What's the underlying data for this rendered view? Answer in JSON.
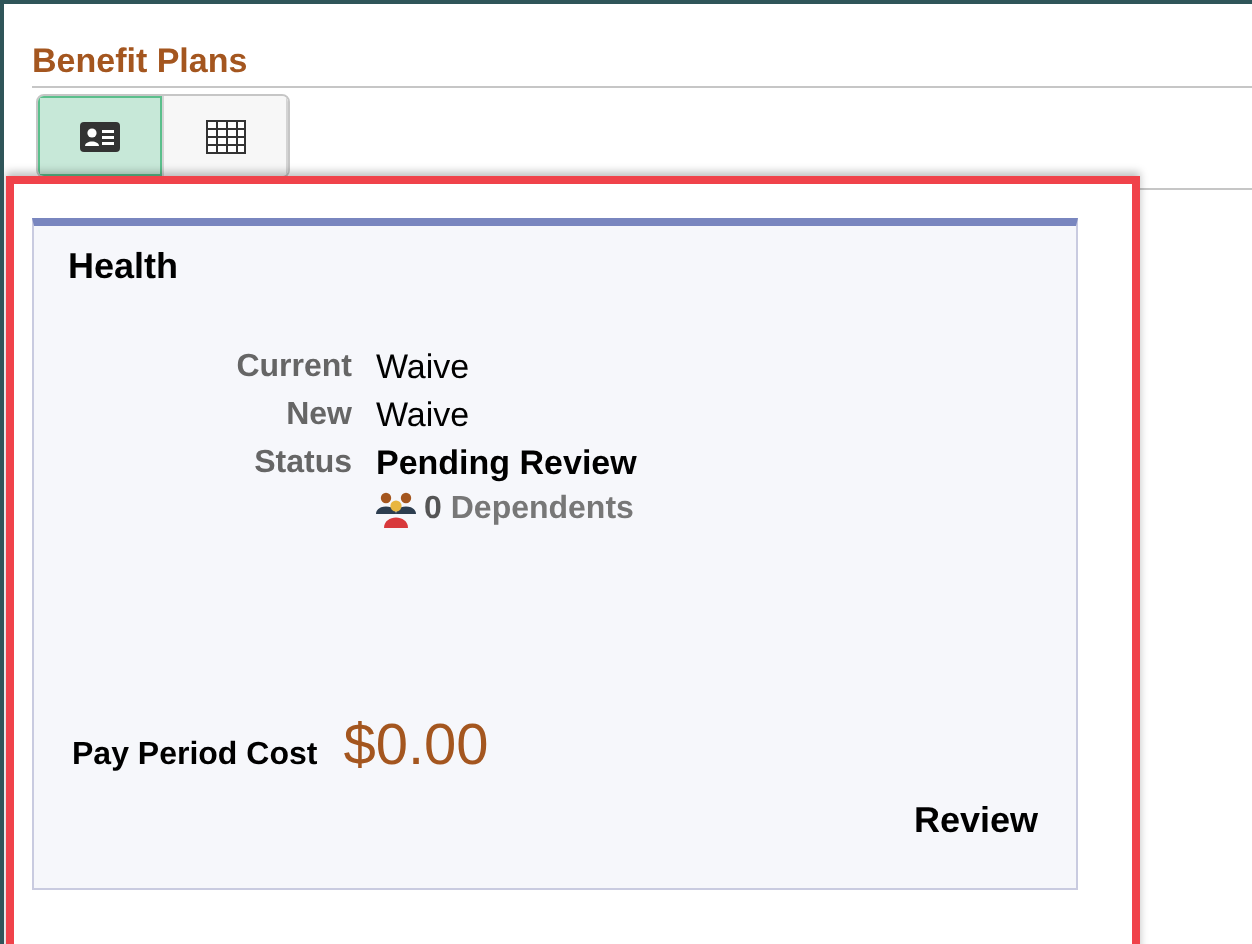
{
  "page": {
    "title": "Benefit Plans"
  },
  "view_toggle": [
    {
      "kind": "card",
      "selected": true
    },
    {
      "kind": "grid",
      "selected": false
    }
  ],
  "plan_card": {
    "title": "Health",
    "fields": [
      {
        "label": "Current",
        "value": "Waive",
        "kind": "plain"
      },
      {
        "label": "New",
        "value": "Waive",
        "kind": "plain"
      },
      {
        "label": "Status",
        "value": "Pending Review",
        "kind": "bold"
      }
    ],
    "dependents": {
      "count": "0",
      "label": "Dependents"
    },
    "cost": {
      "label": "Pay Period Cost",
      "value": "$0.00"
    },
    "action": "Review"
  }
}
